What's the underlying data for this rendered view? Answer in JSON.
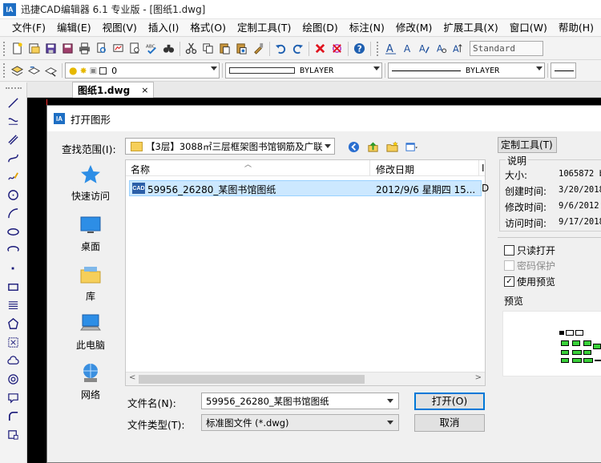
{
  "window": {
    "title": "迅捷CAD编辑器 6.1 专业版  - [图纸1.dwg]",
    "logo_text": "IA"
  },
  "menu": [
    {
      "label": "文件(F)"
    },
    {
      "label": "编辑(E)"
    },
    {
      "label": "视图(V)"
    },
    {
      "label": "插入(I)"
    },
    {
      "label": "格式(O)"
    },
    {
      "label": "定制工具(T)"
    },
    {
      "label": "绘图(D)"
    },
    {
      "label": "标注(N)"
    },
    {
      "label": "修改(M)"
    },
    {
      "label": "扩展工具(X)"
    },
    {
      "label": "窗口(W)"
    },
    {
      "label": "帮助(H)"
    }
  ],
  "toolbar": {
    "text_style": "Standard",
    "layer_value": "0",
    "color_value": "BYLAYER",
    "linetype_value": "BYLAYER"
  },
  "document_tab": {
    "label": "图纸1.dwg",
    "close": "×"
  },
  "dialog": {
    "title": "打开图形",
    "look_in_label": "查找范围(I):",
    "look_in_value": "【3层】3088㎡三层框架图书馆钢筋及广联",
    "places": [
      {
        "label": "快速访问",
        "icon": "star-icon"
      },
      {
        "label": "桌面",
        "icon": "desktop-icon"
      },
      {
        "label": "库",
        "icon": "library-folder-icon"
      },
      {
        "label": "此电脑",
        "icon": "computer-icon"
      },
      {
        "label": "网络",
        "icon": "network-icon"
      }
    ],
    "columns": {
      "name": "名称",
      "date": "修改日期",
      "extra": "Ι"
    },
    "files": [
      {
        "name": "59956_26280_某图书馆图纸",
        "date": "2012/9/6 星期四 15...",
        "extra": "D",
        "icon_text": "CAD"
      }
    ],
    "file_name_label": "文件名(N):",
    "file_name_value": "59956_26280_某图书馆图纸",
    "file_type_label": "文件类型(T):",
    "file_type_value": "标准图文件 (*.dwg)",
    "open_button": "打开(O)",
    "cancel_button": "取消",
    "custom_tools_button": "定制工具(T)",
    "description": {
      "title": "说明",
      "rows": [
        {
          "label": "大小:",
          "value": "1065872 b"
        },
        {
          "label": "创建时间:",
          "value": "3/20/2018"
        },
        {
          "label": "修改时间:",
          "value": "9/6/2012"
        },
        {
          "label": "访问时间:",
          "value": "9/17/2018"
        }
      ]
    },
    "options": {
      "read_only": {
        "label": "只读打开",
        "checked": false
      },
      "password": {
        "label": "密码保护",
        "checked": false
      },
      "use_preview": {
        "label": "使用预览",
        "checked": true
      }
    },
    "preview_label": "预览"
  }
}
